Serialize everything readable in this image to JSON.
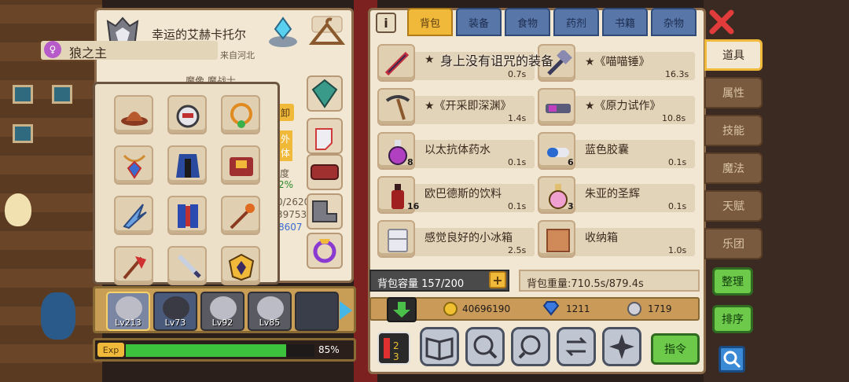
{
  "character": {
    "name": "幸运的艾赫卡托尔",
    "title_badge": "♀",
    "title": "狼之主",
    "origin": "来自河北",
    "partial_subtitle": "魔像 魔战士",
    "partial_side": [
      "卸",
      "外",
      "体",
      "度",
      "2%",
      "0/2620",
      "39753",
      "8607"
    ]
  },
  "equipment_slots": [
    {
      "name": "hat",
      "icon": "hat-icon"
    },
    {
      "name": "helmet",
      "icon": "helmet-icon"
    },
    {
      "name": "necklace",
      "icon": "necklace-icon"
    },
    {
      "name": "amulet",
      "icon": "amulet-icon"
    },
    {
      "name": "cape",
      "icon": "cape-icon"
    },
    {
      "name": "backpack",
      "icon": "backpack-icon"
    },
    {
      "name": "wing",
      "icon": "wing-icon"
    },
    {
      "name": "armor",
      "icon": "armor-icon"
    },
    {
      "name": "staff",
      "icon": "staff-icon"
    },
    {
      "name": "axe",
      "icon": "axe-icon"
    },
    {
      "name": "sword",
      "icon": "sword-icon"
    },
    {
      "name": "emblem",
      "icon": "emblem-icon"
    }
  ],
  "party": [
    {
      "level": "Lv213",
      "active": true
    },
    {
      "level": "Lv73",
      "active": false
    },
    {
      "level": "Lv92",
      "active": false
    },
    {
      "level": "Lv85",
      "active": false
    },
    {
      "level": "",
      "active": false
    }
  ],
  "exp": {
    "label": "Exp",
    "percent_text": "85%",
    "percent": 0.85
  },
  "inventory": {
    "tabs": [
      "背包",
      "装备",
      "食物",
      "药剂",
      "书籍",
      "杂物"
    ],
    "active_tab": 0,
    "banner": "身上没有诅咒的装备",
    "items": [
      {
        "name": "★",
        "time": "0.7s",
        "qty": ""
      },
      {
        "name": "★《喵喵锤》",
        "time": "16.3s",
        "qty": ""
      },
      {
        "name": "★《开采即深渊》",
        "time": "1.4s",
        "qty": ""
      },
      {
        "name": "★《原力试作》",
        "time": "10.8s",
        "qty": ""
      },
      {
        "name": "以太抗体药水",
        "time": "0.1s",
        "qty": "8"
      },
      {
        "name": "蓝色胶囊",
        "time": "0.1s",
        "qty": "6"
      },
      {
        "name": "欧巴德斯的饮料",
        "time": "0.1s",
        "qty": "16"
      },
      {
        "name": "朱亚的圣辉",
        "time": "0.1s",
        "qty": "3"
      },
      {
        "name": "感觉良好的小冰箱",
        "time": "2.5s",
        "qty": ""
      },
      {
        "name": "收纳箱",
        "time": "1.0s",
        "qty": ""
      }
    ],
    "capacity": "背包容量 157/200",
    "capacity_plus": "+",
    "weight": "背包重量:710.5s/879.4s"
  },
  "currency": {
    "gold": "40696190",
    "gems": "1211",
    "silver": "1719"
  },
  "actions": {
    "command": "指令",
    "sort": "排序",
    "organize": "整理"
  },
  "sidebar": {
    "tabs": [
      "道具",
      "属性",
      "技能",
      "魔法",
      "天赋",
      "乐团"
    ],
    "active_tab": 0
  },
  "colors": {
    "accent": "#f0b93a",
    "panel": "#f1e7d2",
    "tab_blue": "#5876a8",
    "green": "#6cc94a",
    "close": "#e23b3b"
  }
}
